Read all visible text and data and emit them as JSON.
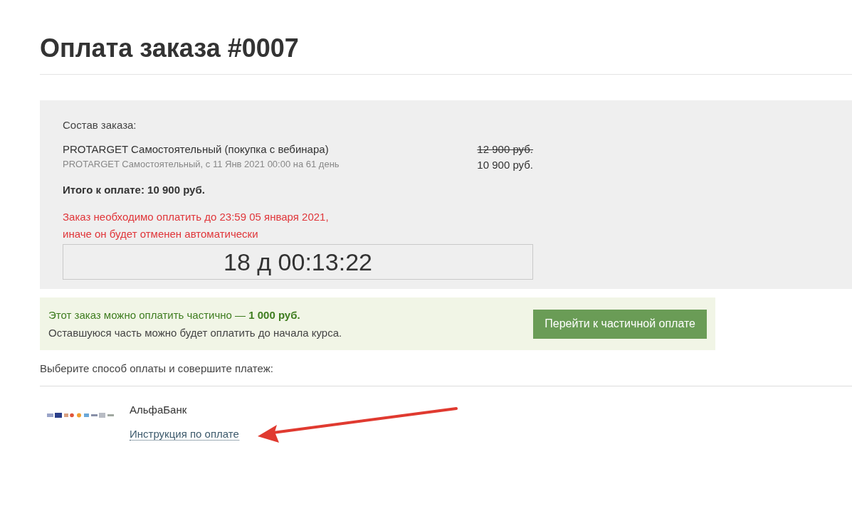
{
  "page_title": "Оплата заказа #0007",
  "order": {
    "heading": "Состав заказа:",
    "items": [
      {
        "name": "PROTARGET Самостоятельный (покупка с вебинара)",
        "details": "PROTARGET Самостоятельный, с 11 Янв 2021 00:00 на 61 день",
        "old_price": "12 900 руб.",
        "price": "10 900 руб."
      }
    ],
    "total": "Итого к оплате: 10 900 руб.",
    "deadline_lines": [
      "Заказ необходимо оплатить до 23:59 05 января 2021,",
      "иначе он будет отменен автоматически"
    ],
    "countdown": "18 д 00:13:22"
  },
  "partial_payment": {
    "text": "Этот заказ можно оплатить частично — **1 000 руб.**",
    "note": "Оставшуюся часть можно будет оплатить до начала курса.",
    "button": "Перейти к частичной оплате"
  },
  "payment_prompt": "Выберите способ оплаты и совершите платеж:",
  "payment_methods": [
    {
      "name": "АльфаБанк",
      "link": "Инструкция по оплате"
    }
  ]
}
